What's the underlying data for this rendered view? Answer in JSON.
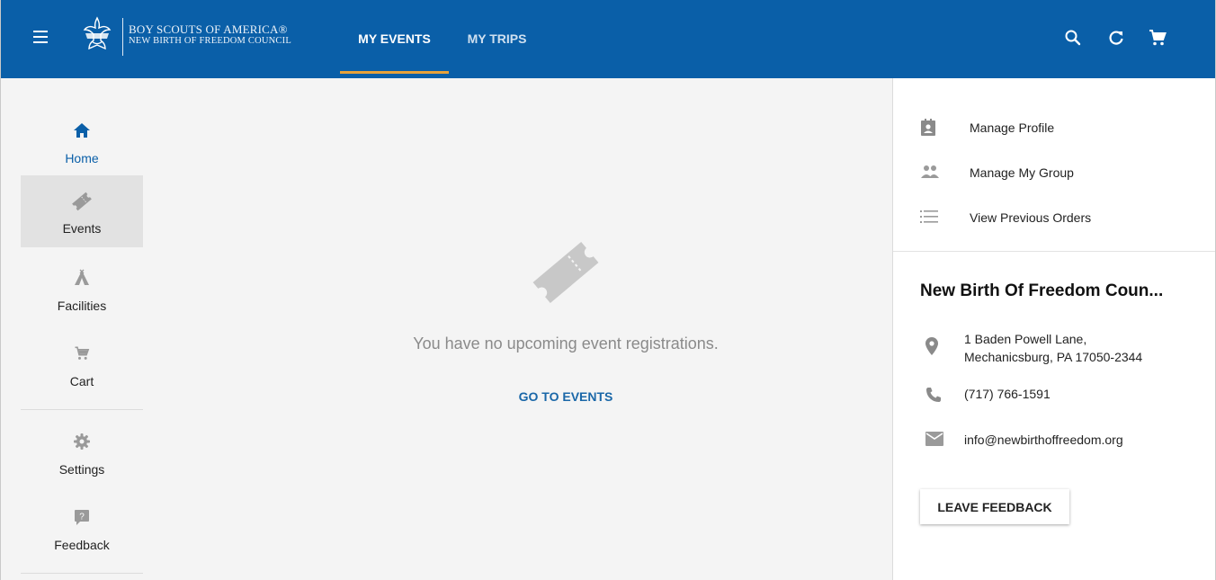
{
  "header": {
    "brand_line1": "BOY SCOUTS OF AMERICA®",
    "brand_line2": "NEW BIRTH OF FREEDOM COUNCIL",
    "tabs": [
      {
        "label": "MY EVENTS",
        "active": true
      },
      {
        "label": "MY TRIPS",
        "active": false
      }
    ],
    "icons": [
      "menu-icon",
      "bsa-logo",
      "search-icon",
      "refresh-icon",
      "cart-icon"
    ],
    "accent_color": "#0a5fa8",
    "tab_indicator_color": "#e8a23a"
  },
  "rail": {
    "items": [
      {
        "label": "Home",
        "icon": "home-icon",
        "active": false
      },
      {
        "label": "Events",
        "icon": "ticket-icon",
        "active": true
      },
      {
        "label": "Facilities",
        "icon": "tent-icon",
        "active": false
      },
      {
        "label": "Cart",
        "icon": "cart-icon",
        "active": false
      },
      {
        "label": "Settings",
        "icon": "gear-icon",
        "active": false
      },
      {
        "label": "Feedback",
        "icon": "feedback-icon",
        "active": false
      }
    ]
  },
  "main": {
    "empty_message": "You have no upcoming event registrations.",
    "go_to_events_label": "GO TO EVENTS"
  },
  "panel": {
    "links": [
      {
        "label": "Manage Profile",
        "icon": "profile-icon"
      },
      {
        "label": "Manage My Group",
        "icon": "group-icon"
      },
      {
        "label": "View Previous Orders",
        "icon": "list-icon"
      }
    ],
    "council": {
      "name": "New Birth Of Freedom Coun...",
      "address_line1": "1 Baden Powell Lane,",
      "address_line2": "Mechanicsburg, PA 17050-2344",
      "phone": "(717) 766-1591",
      "email": "info@newbirthoffreedom.org"
    },
    "feedback_label": "LEAVE FEEDBACK"
  }
}
